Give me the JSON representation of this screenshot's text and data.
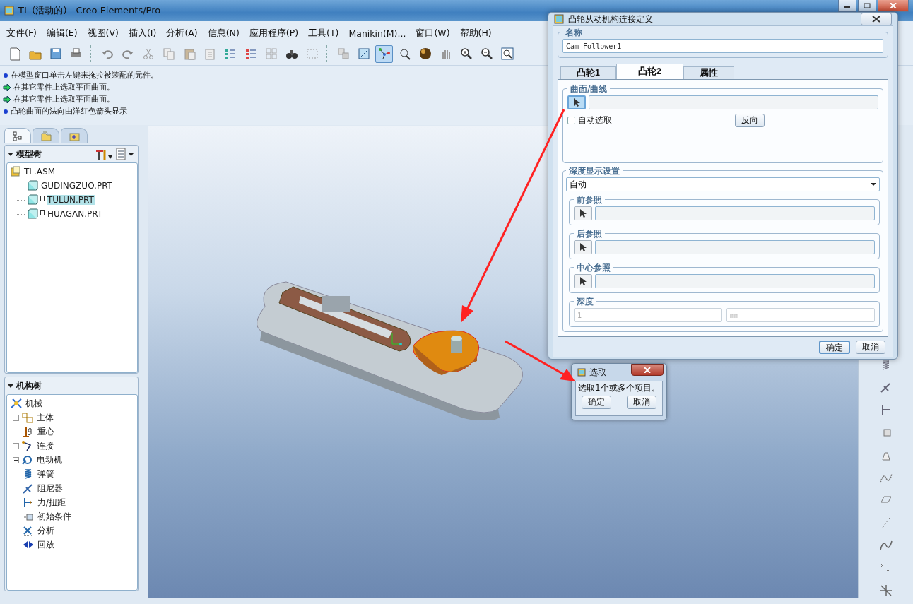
{
  "window": {
    "title": "TL (活动的) - Creo Elements/Pro"
  },
  "menu": [
    "文件(F)",
    "编辑(E)",
    "视图(V)",
    "插入(I)",
    "分析(A)",
    "信息(N)",
    "应用程序(P)",
    "工具(T)",
    "Manikin(M)...",
    "窗口(W)",
    "帮助(H)"
  ],
  "toolbar": [
    {
      "pressed": false
    },
    {
      "pressed": false
    },
    {
      "pressed": false
    },
    {
      "pressed": false
    },
    {
      "pressed": false
    },
    {
      "pressed": false
    },
    {
      "pressed": false
    },
    {
      "pressed": false
    },
    {
      "pressed": false
    },
    {
      "pressed": false
    },
    {
      "pressed": false
    },
    {
      "pressed": false
    },
    {
      "pressed": false
    },
    {
      "pressed": false
    },
    {
      "pressed": false
    },
    {
      "pressed": false
    },
    {
      "pressed": false
    },
    {
      "pressed": true
    },
    {
      "pressed": false
    },
    {
      "pressed": false
    },
    {
      "pressed": false
    },
    {
      "pressed": false
    },
    {
      "pressed": false
    },
    {
      "pressed": false
    }
  ],
  "messages": [
    {
      "kind": "info",
      "text": "在模型窗口单击左键来拖拉被装配的元件。"
    },
    {
      "kind": "prompt",
      "text": "在其它零件上选取平面曲面。"
    },
    {
      "kind": "prompt",
      "text": "在其它零件上选取平面曲面。"
    },
    {
      "kind": "info",
      "text": "凸轮曲面的法向由洋红色箭头显示"
    }
  ],
  "navigator_tabs": [
    {
      "selected": true
    },
    {
      "selected": false
    },
    {
      "selected": false
    }
  ],
  "model_tree": {
    "title": "模型树",
    "root": {
      "label": "TL.ASM",
      "children": [
        {
          "label": "GUDINGZUO.PRT",
          "marked": false,
          "selected": false
        },
        {
          "label": "TULUN.PRT",
          "marked": true,
          "selected": true
        },
        {
          "label": "HUAGAN.PRT",
          "marked": true,
          "selected": false
        }
      ]
    }
  },
  "mechanism_tree": {
    "title": "机构树",
    "root": {
      "label": "机械",
      "children": [
        {
          "label": "主体",
          "expandable": true
        },
        {
          "label": "重心",
          "expandable": false
        },
        {
          "label": "连接",
          "expandable": true
        },
        {
          "label": "电动机",
          "expandable": true
        },
        {
          "label": "弹簧",
          "expandable": false
        },
        {
          "label": "阻尼器",
          "expandable": false
        },
        {
          "label": "力/扭距",
          "expandable": false
        },
        {
          "label": "初始条件",
          "expandable": false
        },
        {
          "label": "分析",
          "expandable": false
        },
        {
          "label": "回放",
          "expandable": false
        }
      ]
    }
  },
  "cam_dialog": {
    "title": "凸轮从动机构连接定义",
    "name_label": "名称",
    "name_value": "Cam Follower1",
    "tabs": [
      {
        "label": "凸轮1",
        "selected": false
      },
      {
        "label": "凸轮2",
        "selected": true
      },
      {
        "label": "属性",
        "selected": false
      }
    ],
    "surface_group": "曲面/曲线",
    "auto_select": {
      "label": "自动选取",
      "checked": false
    },
    "flip_button": "反向",
    "depth_group": "深度显示设置",
    "depth_mode": "自动",
    "references": [
      {
        "label": "前参照"
      },
      {
        "label": "后参照"
      },
      {
        "label": "中心参照"
      }
    ],
    "depth": {
      "label": "深度",
      "value": "1",
      "unit": "mm"
    },
    "buttons": [
      "确定",
      "取消"
    ]
  },
  "select_dialog": {
    "title": "选取",
    "message": "选取1个或多个项目。",
    "buttons": [
      "确定",
      "取消"
    ]
  }
}
